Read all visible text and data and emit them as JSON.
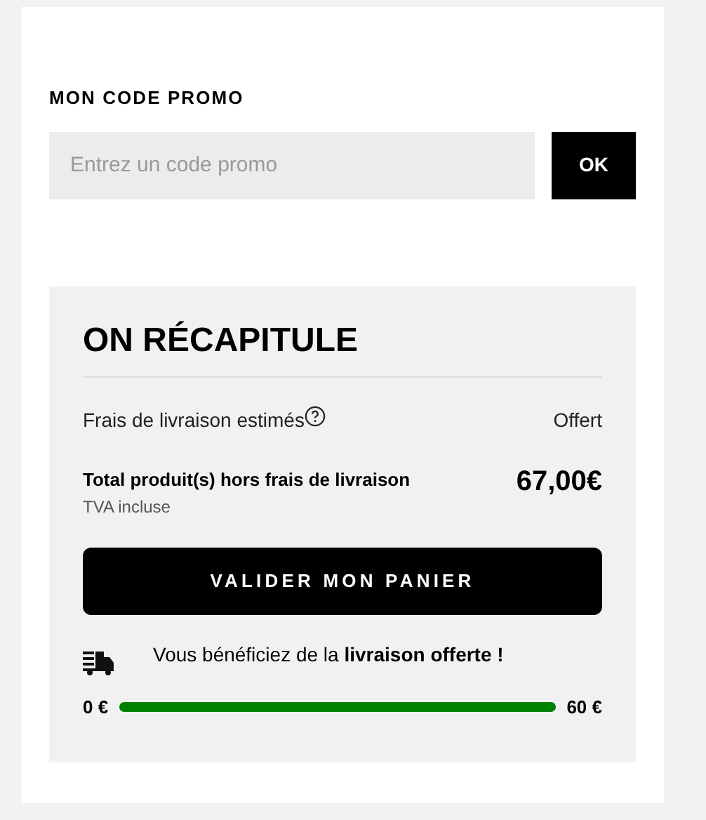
{
  "promo": {
    "title": "MON CODE PROMO",
    "placeholder": "Entrez un code promo",
    "button": "OK"
  },
  "summary": {
    "title": "ON RÉCAPITULE",
    "shipping": {
      "label": "Frais de livraison estimés",
      "value": "Offert"
    },
    "total": {
      "label": "Total produit(s) hors frais de livraison",
      "value": "67,00€",
      "note": "TVA incluse"
    },
    "checkout_button": "VALIDER MON PANIER",
    "free_shipping": {
      "message": "Vous bénéficiez de la **livraison offerte !**",
      "min": "0 €",
      "max": "60 €",
      "level": 1
    }
  }
}
